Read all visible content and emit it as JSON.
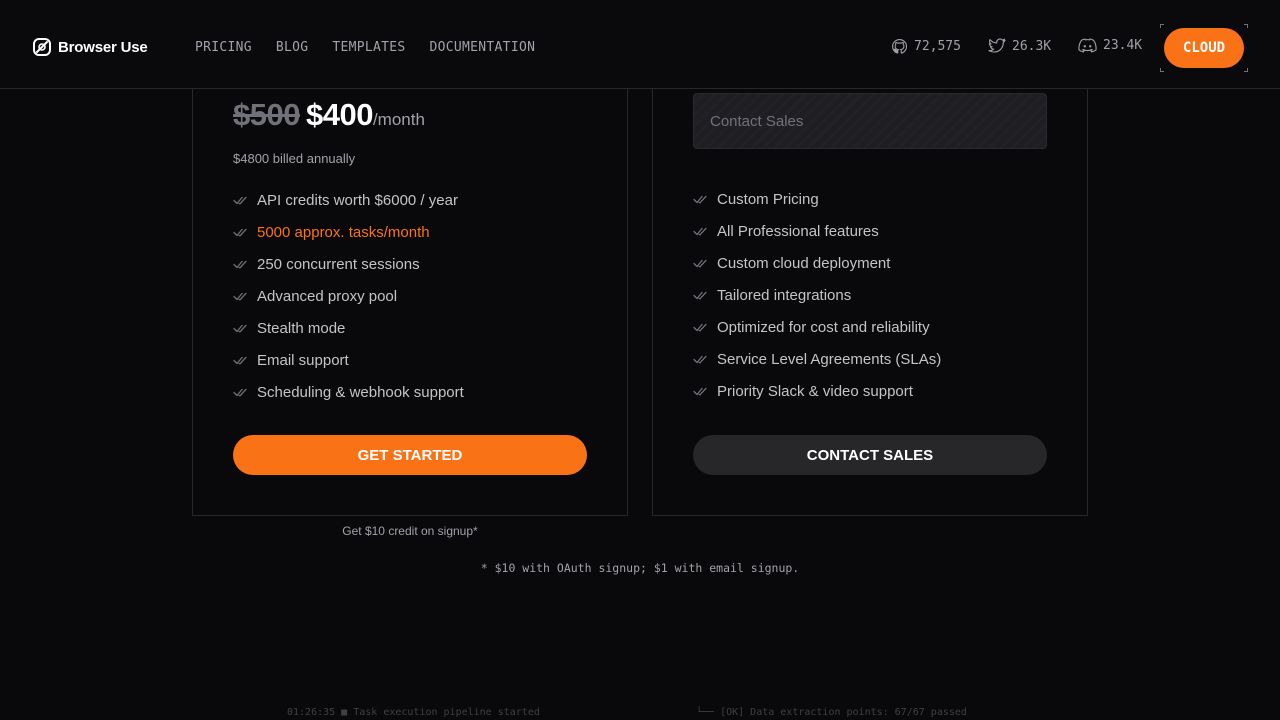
{
  "header": {
    "brand": "Browser Use",
    "nav": [
      "PRICING",
      "BLOG",
      "TEMPLATES",
      "DOCUMENTATION"
    ],
    "stats": {
      "github": "72,575",
      "twitter": "26.3K",
      "discord": "23.4K"
    },
    "cloud_label": "CLOUD",
    "accent_color": "#f97316"
  },
  "plans": {
    "left": {
      "price_old": "$500",
      "price_new": "$400",
      "period": "/month",
      "billed": "$4800 billed annually",
      "features": [
        "API credits worth $6000 / year",
        "5000 approx. tasks/month",
        "250 concurrent sessions",
        "Advanced proxy pool",
        "Stealth mode",
        "Email support",
        "Scheduling & webhook support"
      ],
      "cta": "GET STARTED",
      "credit_note": "Get $10 credit on signup*"
    },
    "right": {
      "contact_box": "Contact Sales",
      "features": [
        "Custom Pricing",
        "All Professional features",
        "Custom cloud deployment",
        "Tailored integrations",
        "Optimized for cost and reliability",
        "Service Level Agreements (SLAs)",
        "Priority Slack & video support"
      ],
      "cta": "CONTACT SALES"
    }
  },
  "footnote": "* $10 with OAuth signup; $1 with email signup.",
  "logs": {
    "left": "01:26:35 ■ Task execution pipeline started",
    "right": "└── [OK] Data extraction points: 67/67 passed"
  }
}
